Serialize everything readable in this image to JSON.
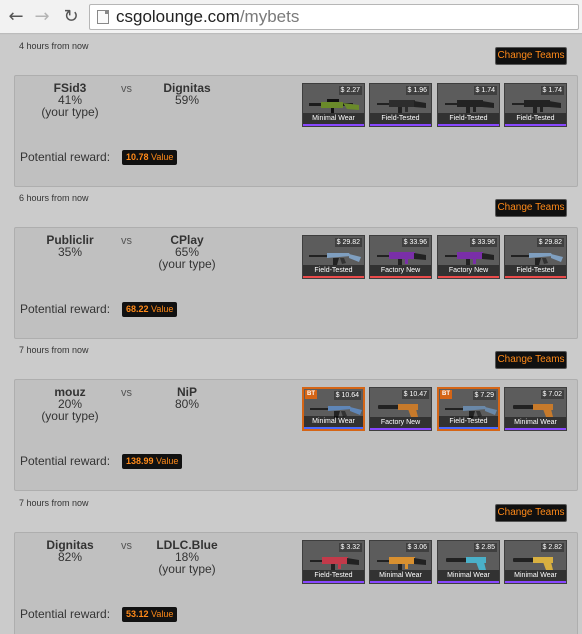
{
  "browser": {
    "url_domain": "csgolounge.com",
    "url_path": "/mybets"
  },
  "matches": [
    {
      "when": "4 hours from now",
      "change_label": "Change Teams",
      "team1": {
        "name": "FSid3",
        "percent": "41%",
        "note": "(your type)"
      },
      "team2": {
        "name": "Dignitas",
        "percent": "59%",
        "note": ""
      },
      "vs": "vs",
      "reward_label": "Potential reward:",
      "reward_value": "10.78",
      "reward_unit": "Value",
      "items": [
        {
          "price": "$ 2.27",
          "wear": "Minimal Wear",
          "weapon": "awp",
          "color": "#6a8a2a",
          "rarity": "#8847ff",
          "bt": ""
        },
        {
          "price": "$ 1.96",
          "wear": "Field-Tested",
          "weapon": "smg",
          "color": "#2d2d2d",
          "rarity": "#8847ff",
          "bt": ""
        },
        {
          "price": "$ 1.74",
          "wear": "Field-Tested",
          "weapon": "smg",
          "color": "#222222",
          "rarity": "#8847ff",
          "bt": ""
        },
        {
          "price": "$ 1.74",
          "wear": "Field-Tested",
          "weapon": "smg",
          "color": "#222222",
          "rarity": "#8847ff",
          "bt": ""
        }
      ]
    },
    {
      "when": "6 hours from now",
      "change_label": "Change Teams",
      "team1": {
        "name": "Publiclir",
        "percent": "35%",
        "note": ""
      },
      "team2": {
        "name": "CPlay",
        "percent": "65%",
        "note": "(your type)"
      },
      "vs": "vs",
      "reward_label": "Potential reward:",
      "reward_value": "68.22",
      "reward_unit": "Value",
      "items": [
        {
          "price": "$ 29.82",
          "wear": "Field-Tested",
          "weapon": "rifle",
          "color": "#7f9fc0",
          "rarity": "#eb4b4b",
          "bt": ""
        },
        {
          "price": "$ 33.96",
          "wear": "Factory New",
          "weapon": "smg",
          "color": "#7a2fa8",
          "rarity": "#eb4b4b",
          "bt": ""
        },
        {
          "price": "$ 33.96",
          "wear": "Factory New",
          "weapon": "smg",
          "color": "#7a2fa8",
          "rarity": "#eb4b4b",
          "bt": ""
        },
        {
          "price": "$ 29.82",
          "wear": "Field-Tested",
          "weapon": "rifle",
          "color": "#7f9fc0",
          "rarity": "#eb4b4b",
          "bt": ""
        }
      ]
    },
    {
      "when": "7 hours from now",
      "change_label": "Change Teams",
      "team1": {
        "name": "mouz",
        "percent": "20%",
        "note": "(your type)"
      },
      "team2": {
        "name": "NiP",
        "percent": "80%",
        "note": ""
      },
      "vs": "vs",
      "reward_label": "Potential reward:",
      "reward_value": "138.99",
      "reward_unit": "Value",
      "items": [
        {
          "price": "$ 10.64",
          "wear": "Minimal Wear",
          "weapon": "rifle",
          "color": "#5f86b8",
          "rarity": "#4b69ff",
          "bt": "BT"
        },
        {
          "price": "$ 10.47",
          "wear": "Factory New",
          "weapon": "pistol",
          "color": "#c77a2b",
          "rarity": "#8847ff",
          "bt": ""
        },
        {
          "price": "$ 7.29",
          "wear": "Field-Tested",
          "weapon": "rifle",
          "color": "#6a88a8",
          "rarity": "#4b69ff",
          "bt": "BT"
        },
        {
          "price": "$ 7.02",
          "wear": "Minimal Wear",
          "weapon": "pistol",
          "color": "#c77a2b",
          "rarity": "#8847ff",
          "bt": ""
        }
      ]
    },
    {
      "when": "7 hours from now",
      "change_label": "Change Teams",
      "team1": {
        "name": "Dignitas",
        "percent": "82%",
        "note": ""
      },
      "team2": {
        "name": "LDLC.Blue",
        "percent": "18%",
        "note": "(your type)"
      },
      "vs": "vs",
      "reward_label": "Potential reward:",
      "reward_value": "53.12",
      "reward_unit": "Value",
      "items": [
        {
          "price": "$ 3.32",
          "wear": "Field-Tested",
          "weapon": "smg",
          "color": "#c23a4a",
          "rarity": "#8847ff",
          "bt": ""
        },
        {
          "price": "$ 3.06",
          "wear": "Minimal Wear",
          "weapon": "smg",
          "color": "#d89030",
          "rarity": "#8847ff",
          "bt": ""
        },
        {
          "price": "$ 2.85",
          "wear": "Minimal Wear",
          "weapon": "pistol",
          "color": "#4ab0c8",
          "rarity": "#8847ff",
          "bt": ""
        },
        {
          "price": "$ 2.82",
          "wear": "Minimal Wear",
          "weapon": "pistol",
          "color": "#d8b040",
          "rarity": "#8847ff",
          "bt": ""
        }
      ]
    }
  ]
}
